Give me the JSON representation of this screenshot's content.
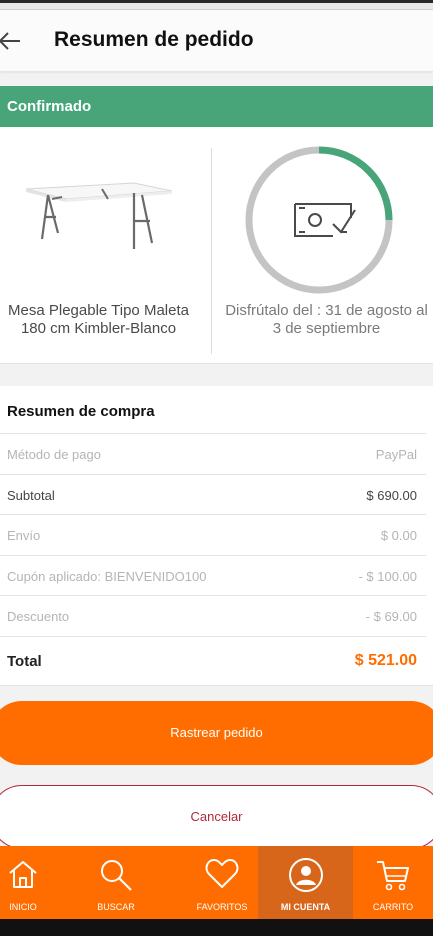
{
  "header": {
    "title": "Resumen de pedido",
    "back_icon": "arrow-left-icon"
  },
  "status": {
    "label": "Confirmado",
    "color": "#48a57a"
  },
  "product": {
    "name": "Mesa Plegable Tipo Maleta 180 cm Kimbler-Blanco",
    "delivery_text": "Disfrútalo del : 31 de agosto al 3 de septiembre",
    "delivery_progress": 0.25,
    "ring_icon": "cash-check-icon"
  },
  "summary": {
    "title": "Resumen de compra",
    "rows": [
      {
        "label": "Método de pago",
        "value": "PayPal"
      },
      {
        "label": "Subtotal",
        "value": "$ 690.00"
      },
      {
        "label": "Envío",
        "value": "$ 0.00"
      },
      {
        "label": "Cupón aplicado: BIENVENIDO100",
        "value": "- $ 100.00"
      },
      {
        "label": "Descuento",
        "value": "- $ 69.00"
      }
    ],
    "total_label": "Total",
    "total_value": "$ 521.00"
  },
  "actions": {
    "track_label": "Rastrear pedido",
    "cancel_label": "Cancelar"
  },
  "nav": {
    "items": [
      {
        "label": "INICIO",
        "icon": "home-icon"
      },
      {
        "label": "BUSCAR",
        "icon": "search-icon"
      },
      {
        "label": "FAVORITOS",
        "icon": "heart-icon"
      },
      {
        "label": "MI CUENTA",
        "icon": "user-icon",
        "active": true
      },
      {
        "label": "CARRITO",
        "icon": "cart-icon"
      }
    ]
  },
  "colors": {
    "accent": "#ff6d00",
    "confirmed": "#48a57a",
    "cancel": "#b02a3a"
  }
}
